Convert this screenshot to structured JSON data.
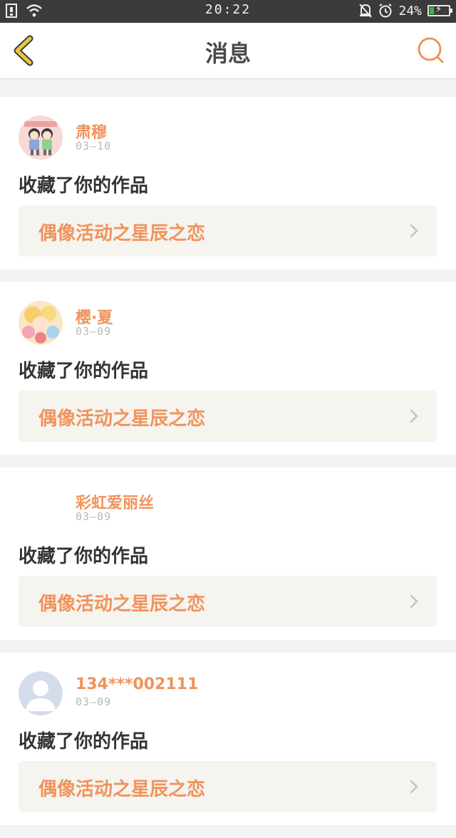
{
  "status_bar": {
    "time": "20:22",
    "battery": "24%",
    "battery_level": 0.24
  },
  "header": {
    "title": "消息",
    "back_icon": "chevron-left-icon",
    "search_icon": "search-icon"
  },
  "messages": [
    {
      "username": "肃穆",
      "date": "03—10",
      "action": "收藏了你的作品",
      "work_title": "偶像活动之星辰之恋",
      "avatar": "cartoon-kids"
    },
    {
      "username": "樱·夏",
      "date": "03—09",
      "action": "收藏了你的作品",
      "work_title": "偶像活动之星辰之恋",
      "avatar": "anime-girl"
    },
    {
      "username": "彩虹爱丽丝",
      "date": "03—09",
      "action": "收藏了你的作品",
      "work_title": "偶像活动之星辰之恋",
      "avatar": "none"
    },
    {
      "username": "134***002111",
      "date": "03—09",
      "action": "收藏了你的作品",
      "work_title": "偶像活动之星辰之恋",
      "avatar": "default-person"
    }
  ],
  "colors": {
    "accent": "#f0935c",
    "back_icon": "#e8c93a",
    "card_bg": "#ffffff",
    "work_bg": "#f5f4ef"
  }
}
